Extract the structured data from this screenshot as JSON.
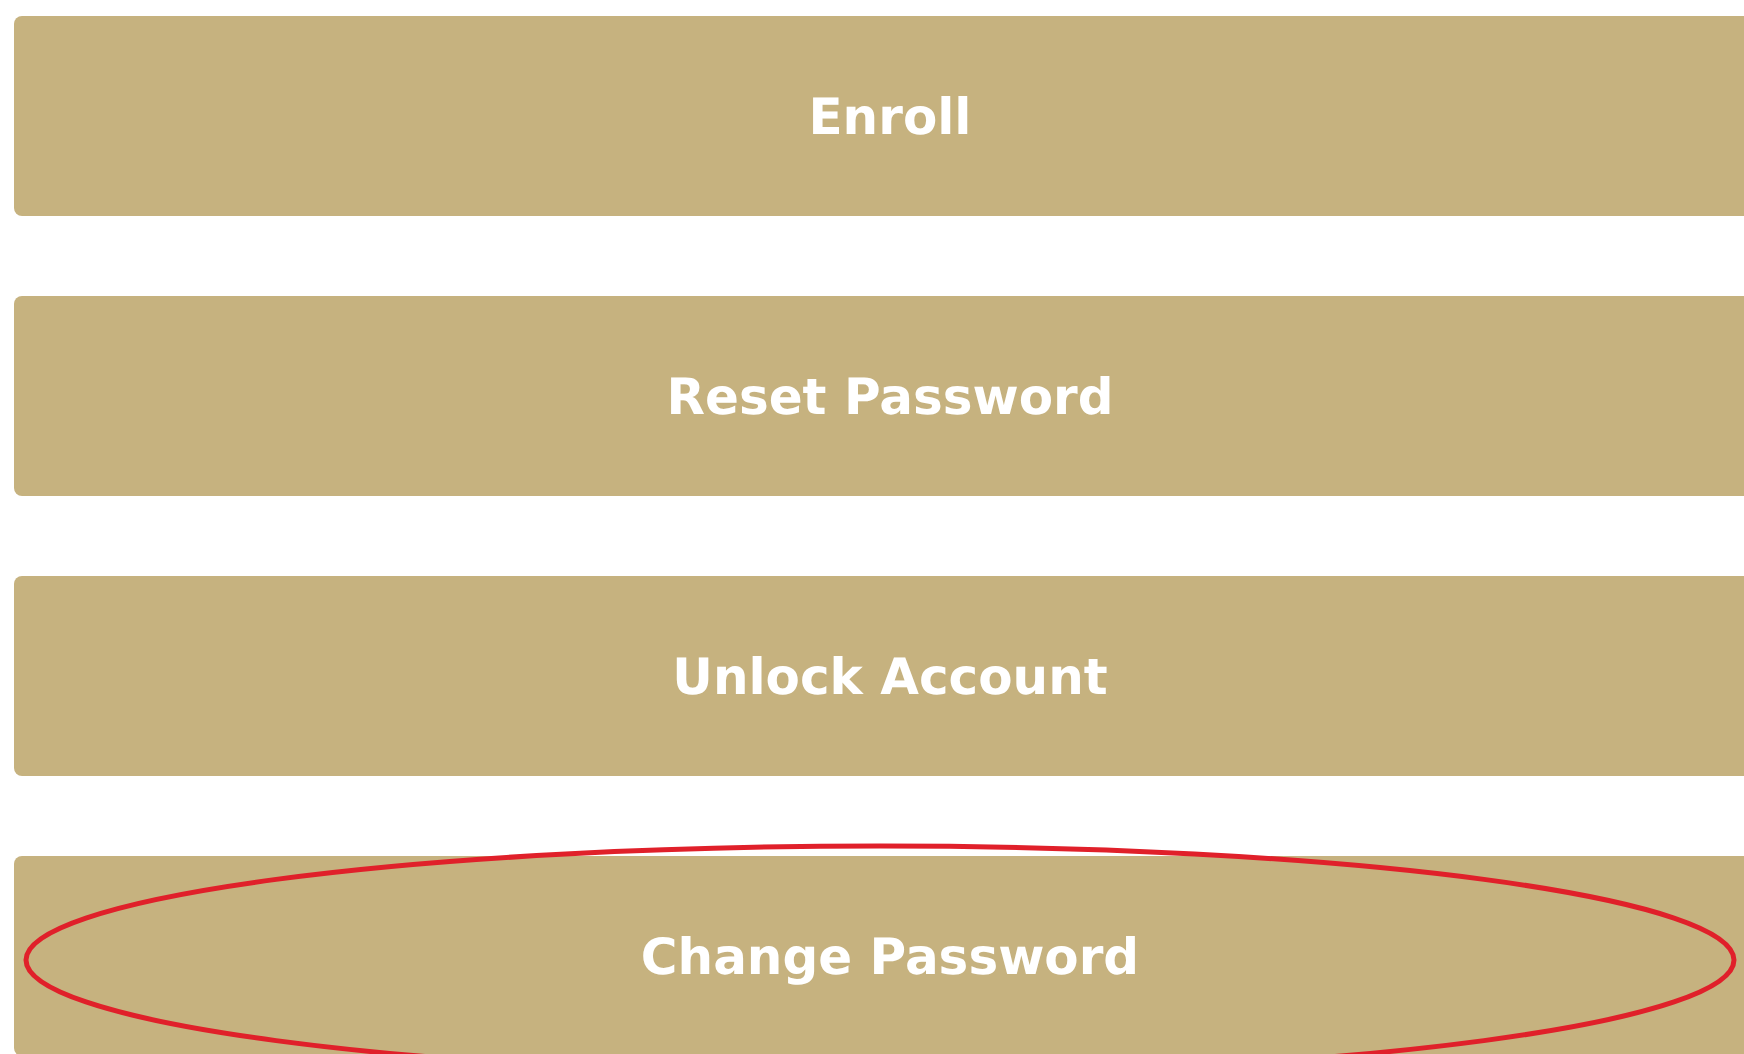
{
  "buttons": [
    {
      "label": "Enroll",
      "circled": false
    },
    {
      "label": "Reset Password",
      "circled": false
    },
    {
      "label": "Unlock Account",
      "circled": false
    },
    {
      "label": "Change Password",
      "circled": true
    }
  ]
}
